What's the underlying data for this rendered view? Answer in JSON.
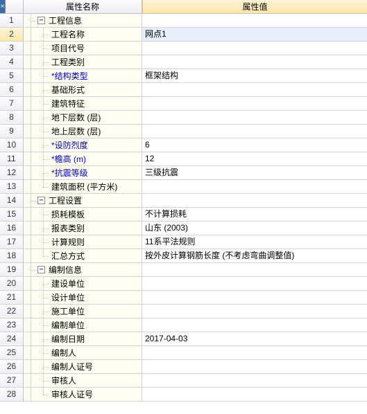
{
  "header": {
    "close_glyph": "×",
    "col_name": "属性名称",
    "col_value": "属性值"
  },
  "expander_glyph": "−",
  "rows": [
    {
      "n": 1,
      "kind": "group",
      "label": "工程信息",
      "value": ""
    },
    {
      "n": 2,
      "kind": "leaf",
      "label": "工程名称",
      "value": "网点1",
      "selected": true
    },
    {
      "n": 3,
      "kind": "leaf",
      "label": "项目代号",
      "value": ""
    },
    {
      "n": 4,
      "kind": "leaf",
      "label": "工程类别",
      "value": ""
    },
    {
      "n": 5,
      "kind": "leaf",
      "label": "*结构类型",
      "value": "框架结构",
      "blue": true
    },
    {
      "n": 6,
      "kind": "leaf",
      "label": "基础形式",
      "value": ""
    },
    {
      "n": 7,
      "kind": "leaf",
      "label": "建筑特征",
      "value": ""
    },
    {
      "n": 8,
      "kind": "leaf",
      "label": "地下层数 (层)",
      "value": ""
    },
    {
      "n": 9,
      "kind": "leaf",
      "label": "地上层数 (层)",
      "value": ""
    },
    {
      "n": 10,
      "kind": "leaf",
      "label": "*设防烈度",
      "value": "6",
      "blue": true
    },
    {
      "n": 11,
      "kind": "leaf",
      "label": "*檐高 (m)",
      "value": "12",
      "blue": true
    },
    {
      "n": 12,
      "kind": "leaf",
      "label": "*抗震等级",
      "value": "三级抗震",
      "blue": true
    },
    {
      "n": 13,
      "kind": "leaf",
      "label": "建筑面积 (平方米)",
      "value": "",
      "last": true
    },
    {
      "n": 14,
      "kind": "group",
      "label": "工程设置",
      "value": ""
    },
    {
      "n": 15,
      "kind": "leaf",
      "label": "损耗模板",
      "value": "不计算损耗"
    },
    {
      "n": 16,
      "kind": "leaf",
      "label": "报表类别",
      "value": "山东 (2003)"
    },
    {
      "n": 17,
      "kind": "leaf",
      "label": "计算规则",
      "value": "11系平法规则"
    },
    {
      "n": 18,
      "kind": "leaf",
      "label": "汇总方式",
      "value": "按外皮计算钢筋长度 (不考虑弯曲调整值)",
      "last": true
    },
    {
      "n": 19,
      "kind": "group",
      "label": "编制信息",
      "value": ""
    },
    {
      "n": 20,
      "kind": "leaf",
      "label": "建设单位",
      "value": ""
    },
    {
      "n": 21,
      "kind": "leaf",
      "label": "设计单位",
      "value": ""
    },
    {
      "n": 22,
      "kind": "leaf",
      "label": "施工单位",
      "value": ""
    },
    {
      "n": 23,
      "kind": "leaf",
      "label": "编制单位",
      "value": ""
    },
    {
      "n": 24,
      "kind": "leaf",
      "label": "编制日期",
      "value": "2017-04-03"
    },
    {
      "n": 25,
      "kind": "leaf",
      "label": "编制人",
      "value": ""
    },
    {
      "n": 26,
      "kind": "leaf",
      "label": "编制人证号",
      "value": ""
    },
    {
      "n": 27,
      "kind": "leaf",
      "label": "审核人",
      "value": ""
    },
    {
      "n": 28,
      "kind": "leaf",
      "label": "审核人证号",
      "value": "",
      "last": true
    }
  ]
}
